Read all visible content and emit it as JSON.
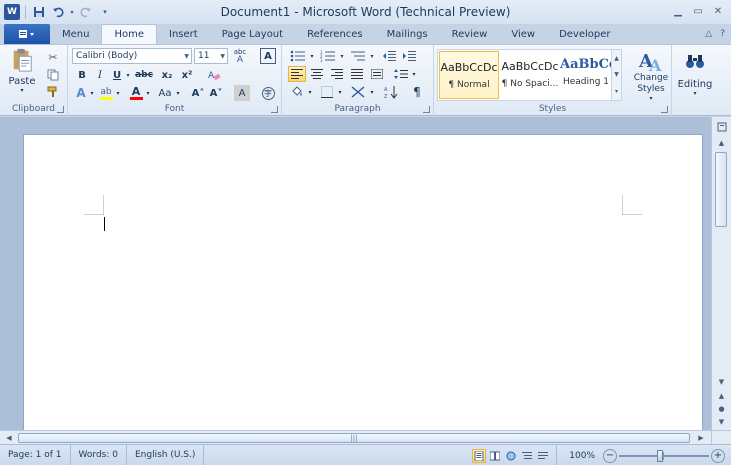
{
  "window": {
    "title": "Document1  -  Microsoft Word (Technical Preview)",
    "app_icon": "word-icon",
    "controls": [
      "minimize-icon",
      "maximize-icon",
      "close-icon"
    ]
  },
  "quick_access": {
    "app_icon_letter": "W",
    "items": [
      "save-icon",
      "undo-icon",
      "redo-icon"
    ]
  },
  "ribbon_tabs": {
    "file_label": "",
    "tabs": [
      "Menu",
      "Home",
      "Insert",
      "Page Layout",
      "References",
      "Mailings",
      "Review",
      "View",
      "Developer"
    ],
    "active": "Home"
  },
  "clipboard": {
    "paste_label": "Paste",
    "group_label": "Clipboard"
  },
  "font": {
    "font_name": "Calibri (Body)",
    "font_size": "11",
    "group_label": "Font",
    "bold": "B",
    "italic": "I",
    "underline": "U",
    "strike": "abc",
    "subscript": "x₂",
    "superscript": "x²",
    "grow": "A˄",
    "shrink": "A˅",
    "change_case": "Aa",
    "clear": "A",
    "colors": {
      "highlight": "#ffff00",
      "font_color": "#ff0000"
    }
  },
  "paragraph": {
    "group_label": "Paragraph",
    "show_marks": "¶"
  },
  "styles": {
    "group_label": "Styles",
    "items": [
      {
        "sample": "AaBbCcDc",
        "name": "¶ Normal",
        "selected": true
      },
      {
        "sample": "AaBbCcDc",
        "name": "¶ No Spaci...",
        "selected": false
      },
      {
        "sample": "AaBbCс",
        "name": "Heading 1",
        "selected": false
      }
    ],
    "change_styles": "Change Styles"
  },
  "editing": {
    "label": "Editing"
  },
  "statusbar": {
    "page": "Page: 1 of 1",
    "words": "Words: 0",
    "language": "English (U.S.)",
    "zoom": "100%",
    "zoom_minus": "−",
    "zoom_plus": "+"
  }
}
